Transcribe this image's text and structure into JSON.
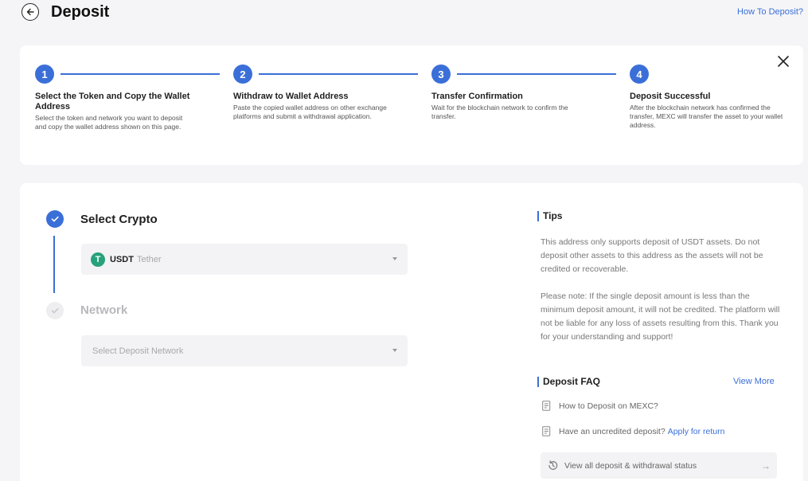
{
  "header": {
    "title": "Deposit",
    "help_link": "How To Deposit?"
  },
  "steps": [
    {
      "number": "1",
      "title": "Select the Token and Copy the Wallet Address",
      "description": "Select the token and network you want to deposit and copy the wallet address shown on this page."
    },
    {
      "number": "2",
      "title": "Withdraw to Wallet Address",
      "description": "Paste the copied wallet address on other exchange platforms and submit a withdrawal application."
    },
    {
      "number": "3",
      "title": "Transfer Confirmation",
      "description": "Wait for the blockchain network to confirm the transfer."
    },
    {
      "number": "4",
      "title": "Deposit Successful",
      "description": "After the blockchain network has confirmed the transfer, MEXC will transfer the asset to your wallet address."
    }
  ],
  "form": {
    "crypto_title": "Select Crypto",
    "crypto_symbol": "USDT",
    "crypto_name": "Tether",
    "crypto_logo_letter": "T",
    "network_title": "Network",
    "network_placeholder": "Select Deposit Network"
  },
  "tips": {
    "title": "Tips",
    "paragraphs": [
      "This address only supports deposit of USDT assets. Do not deposit other assets to this address as the assets will not be credited or recoverable.",
      "Please note: If the single deposit amount is less than the minimum deposit amount, it will not be credited. The platform will not be liable for any loss of assets resulting from this. Thank you for your understanding and support!"
    ]
  },
  "faq": {
    "title": "Deposit FAQ",
    "view_more": "View More",
    "items": [
      {
        "text": "How to Deposit on MEXC?"
      },
      {
        "text": "Have an uncredited deposit?",
        "link": "Apply for return"
      }
    ],
    "status_link": "View all deposit & withdrawal status"
  },
  "icons": {
    "back": "arrow-left-icon",
    "close": "close-icon",
    "check": "check-icon",
    "caret": "caret-down-icon",
    "document": "document-icon",
    "history": "history-icon",
    "arrow_right": "arrow-right-icon"
  },
  "colors": {
    "accent": "#3b6fd8",
    "tether_green": "#26a17b"
  }
}
